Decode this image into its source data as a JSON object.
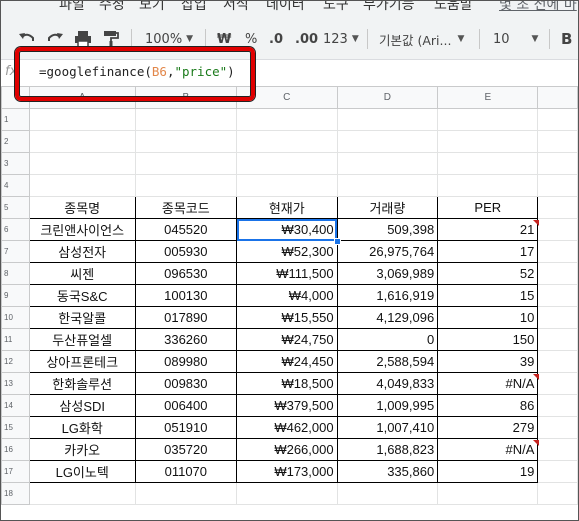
{
  "menu": [
    "파일",
    "수정",
    "보기",
    "삽입",
    "서식",
    "데이터",
    "도구",
    "부가기능",
    "도움말",
    "몇 초 전에 마"
  ],
  "toolbar": {
    "zoom": "100%",
    "currency": "₩",
    "percent": "%",
    "decrease_decimal": ".0",
    "increase_decimal": ".00",
    "more_formats": "123",
    "font": "기본값 (Ari...",
    "font_size": "10",
    "bold": "B"
  },
  "formula_bar": {
    "fx": "fx",
    "formula_prefix": "=googlefinance(",
    "formula_ref": "B6",
    "formula_mid": ",",
    "formula_str": "\"price\"",
    "formula_suffix": ")"
  },
  "columns": [
    "A",
    "B",
    "C",
    "D",
    "E"
  ],
  "table": {
    "headers": [
      "종목명",
      "종목코드",
      "현재가",
      "거래량",
      "PER"
    ],
    "rows": [
      [
        "크린앤사이언스",
        "045520",
        "₩30,400",
        "509,398",
        "21"
      ],
      [
        "삼성전자",
        "005930",
        "₩52,300",
        "26,975,764",
        "17"
      ],
      [
        "씨젠",
        "096530",
        "₩111,500",
        "3,069,989",
        "52"
      ],
      [
        "동국S&C",
        "100130",
        "₩4,000",
        "1,616,919",
        "15"
      ],
      [
        "한국알콜",
        "017890",
        "₩15,550",
        "4,129,096",
        "10"
      ],
      [
        "두산퓨얼셀",
        "336260",
        "₩24,750",
        "0",
        "150"
      ],
      [
        "상아프론테크",
        "089980",
        "₩24,450",
        "2,588,594",
        "39"
      ],
      [
        "한화솔루션",
        "009830",
        "₩18,500",
        "4,049,833",
        "#N/A"
      ],
      [
        "삼성SDI",
        "006400",
        "₩379,500",
        "1,009,995",
        "86"
      ],
      [
        "LG화학",
        "051910",
        "₩462,000",
        "1,007,410",
        "279"
      ],
      [
        "카카오",
        "035720",
        "₩266,000",
        "1,688,823",
        "#N/A"
      ],
      [
        "LG이노텍",
        "011070",
        "₩173,000",
        "335,860",
        "19"
      ]
    ]
  },
  "row_numbers": [
    "1",
    "2",
    "3",
    "4",
    "5",
    "6",
    "7",
    "8",
    "9",
    "10",
    "11",
    "12",
    "13",
    "14",
    "15",
    "16",
    "17",
    "18"
  ],
  "colors": {
    "highlight_box": "#e00000",
    "selection": "#1a73e8",
    "error_marker": "#c5221f"
  }
}
